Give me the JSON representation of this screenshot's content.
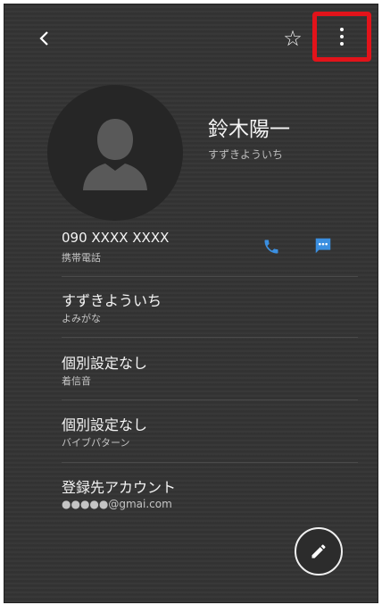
{
  "app_bar": {
    "back_icon": "chevron-left-icon",
    "favorite_icon": "star-outline-icon",
    "favorite_glyph": "☆",
    "more_icon": "more-vert-icon"
  },
  "contact": {
    "name": "鈴木陽一",
    "reading": "すずきよういち",
    "avatar_icon": "person-silhouette-icon"
  },
  "phone": {
    "number": "090 XXXX XXXX",
    "type": "携帯電話",
    "call_icon": "phone-icon",
    "message_icon": "chat-bubble-icon",
    "accent_color": "#3b8fe0"
  },
  "details": [
    {
      "title": "すずきよういち",
      "label": "よみがな"
    },
    {
      "title": "個別設定なし",
      "label": "着信音"
    },
    {
      "title": "個別設定なし",
      "label": "バイブパターン"
    },
    {
      "title": "登録先アカウント",
      "label": "●●●●●@gmai.com"
    }
  ],
  "fab": {
    "icon": "pencil-edit-icon"
  },
  "colors": {
    "highlight": "#e2131a",
    "background": "#333333"
  }
}
